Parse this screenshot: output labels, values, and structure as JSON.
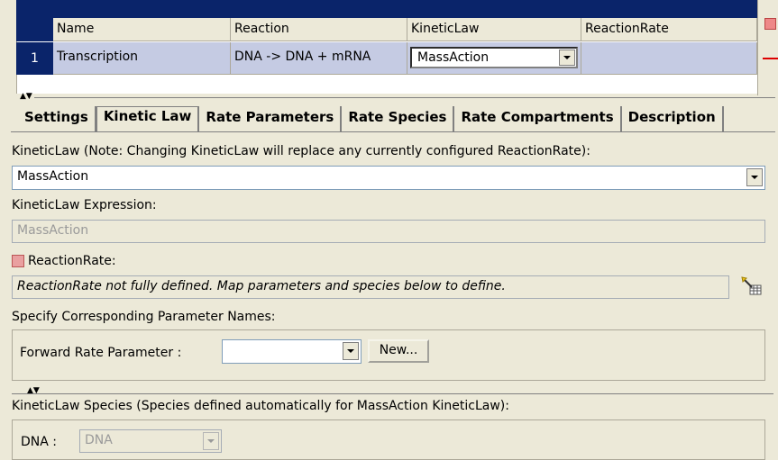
{
  "reaction_table": {
    "columns": [
      "Name",
      "Reaction",
      "KineticLaw",
      "ReactionRate"
    ],
    "rows": [
      {
        "num": "1",
        "name": "Transcription",
        "reaction": "DNA -> DNA + mRNA",
        "kinetic_law": "MassAction",
        "reaction_rate": ""
      }
    ]
  },
  "tabs": [
    "Settings",
    "Kinetic Law",
    "Rate Parameters",
    "Rate Species",
    "Rate Compartments",
    "Description"
  ],
  "active_tab": "Kinetic Law",
  "kinetic_law": {
    "label": "KineticLaw (Note: Changing KineticLaw will replace any currently configured ReactionRate):",
    "value": "MassAction",
    "expression_label": "KineticLaw Expression:",
    "expression_value": "MassAction",
    "reaction_rate_label": "ReactionRate:",
    "reaction_rate_message": "ReactionRate not fully defined. Map parameters and species below to define.",
    "param_names_label": "Specify Corresponding Parameter Names:",
    "forward_rate_label": "Forward Rate Parameter :",
    "forward_rate_value": "",
    "new_button": "New...",
    "species_label": "KineticLaw Species (Species defined automatically for MassAction KineticLaw):",
    "dna_label": "DNA :",
    "dna_value": "DNA"
  },
  "colors": {
    "selection": "#0a246a",
    "row_highlight": "#c5cbe3",
    "error": "#e9a0a0"
  }
}
